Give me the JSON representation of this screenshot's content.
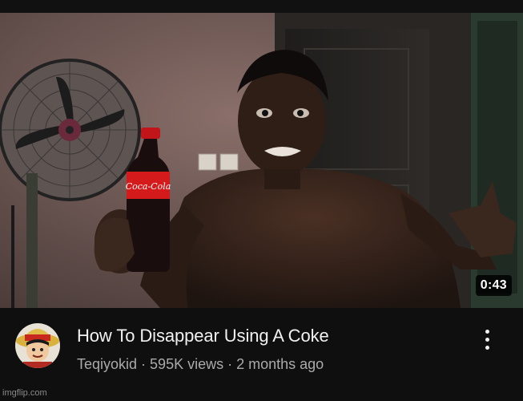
{
  "video": {
    "duration": "0:43",
    "title": "How To Disappear Using A Coke",
    "channel": "Teqiyokid",
    "separator": " · ",
    "views": "595K views",
    "age": "2 months ago"
  },
  "bottle": {
    "brand": "Coca-Cola"
  },
  "icons": {
    "menu": "more-vert-icon",
    "avatar": "channel-avatar"
  },
  "colors": {
    "background": "#0f0f0f",
    "title": "#f1f1f1",
    "secondary": "#aaaaaa",
    "coke_red": "#d41a1a"
  },
  "watermark": "imgflip.com"
}
